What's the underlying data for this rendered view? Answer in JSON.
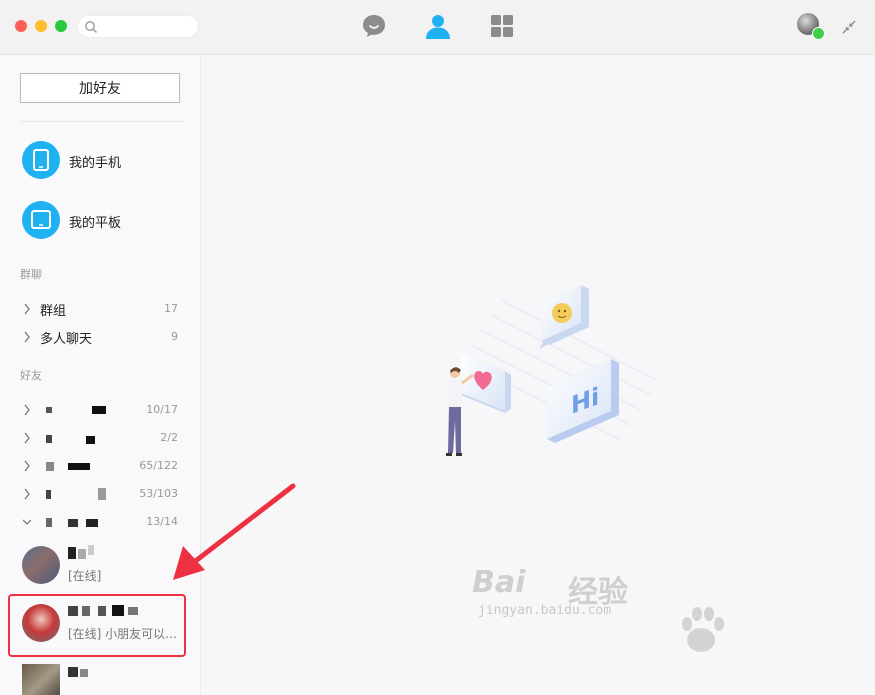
{
  "titlebar": {
    "search": {
      "placeholder": "",
      "value": ""
    },
    "nav": [
      "chat-icon",
      "contacts-icon",
      "apps-icon"
    ],
    "active_nav": "contacts"
  },
  "sidebar": {
    "add_friend_label": "加好友",
    "devices": [
      {
        "label": "我的手机",
        "icon": "phone-icon"
      },
      {
        "label": "我的平板",
        "icon": "tablet-icon"
      }
    ],
    "group_chat_title": "群聊",
    "group_chats": [
      {
        "label": "群组",
        "count": "17"
      },
      {
        "label": "多人聊天",
        "count": "9"
      }
    ],
    "friends_title": "好友",
    "friend_groups": [
      {
        "count": "10/17",
        "expanded": false
      },
      {
        "count": "2/2",
        "expanded": false
      },
      {
        "count": "65/122",
        "expanded": false
      },
      {
        "count": "53/103",
        "expanded": false
      },
      {
        "count": "13/14",
        "expanded": true
      }
    ],
    "contacts": [
      {
        "status": "[在线]"
      },
      {
        "status": "[在线] 小朋友可以…"
      }
    ]
  },
  "watermark": {
    "brand": "Bai",
    "text": "经验",
    "site": "jingyan.baidu.com"
  },
  "colors": {
    "accent": "#1fb2f0",
    "highlight": "#ee3142",
    "online": "#3fd04a"
  }
}
